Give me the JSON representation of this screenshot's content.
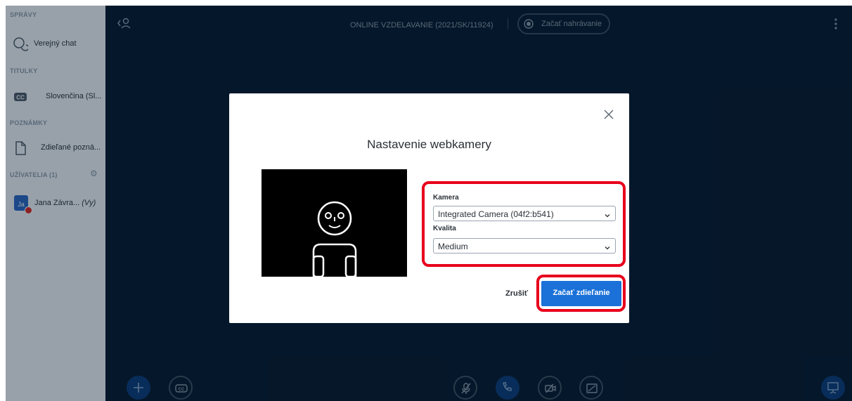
{
  "sidebar": {
    "messages_title": "SPRÁVY",
    "public_chat": "Verejný chat",
    "captions_title": "TITULKY",
    "captions_item": "Slovenčina (Sl...",
    "notes_title": "POZNÁMKY",
    "notes_item": "Zdieľané pozná...",
    "users_title": "UŽÍVATELIA (1)",
    "user": {
      "initials": "Ja",
      "name": "Jana Závra...",
      "you": "(Vy)"
    }
  },
  "topbar": {
    "meeting_title": "ONLINE VZDELAVANIE (2021/SK/11924)",
    "record_label": "Začať nahrávanie"
  },
  "modal": {
    "title": "Nastavenie webkamery",
    "camera_label": "Kamera",
    "camera_value": "Integrated Camera (04f2:b541)",
    "quality_label": "Kvalita",
    "quality_value": "Medium",
    "cancel_label": "Zrušiť",
    "start_label": "Začať zdieľanie"
  },
  "colors": {
    "main_bg": "#06172a",
    "sidebar_bg": "#f3f6f9",
    "primary": "#1b71d8",
    "highlight": "#e8001c"
  }
}
